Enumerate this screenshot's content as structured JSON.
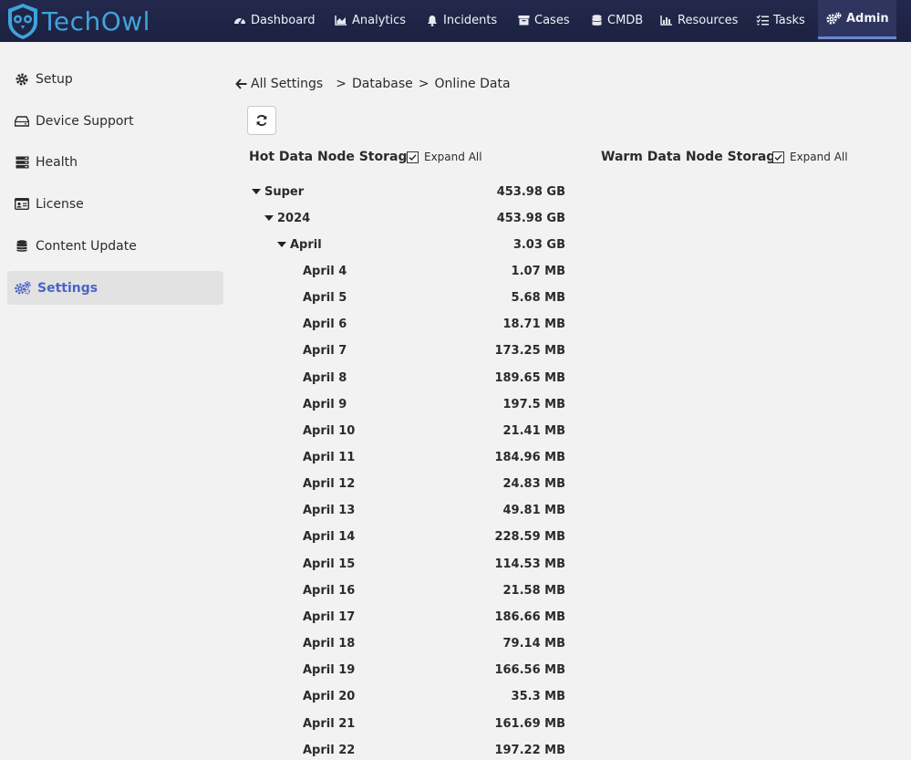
{
  "app": {
    "brand": "TechOwl",
    "brand_color": "#3fa3dc",
    "nav_bg": "#23294d",
    "accent": "#4a64c7"
  },
  "nav": {
    "items": [
      {
        "label": "Dashboard",
        "icon": "gauge-icon"
      },
      {
        "label": "Analytics",
        "icon": "area-chart-icon"
      },
      {
        "label": "Incidents",
        "icon": "bell-icon"
      },
      {
        "label": "Cases",
        "icon": "archive-icon"
      },
      {
        "label": "CMDB",
        "icon": "database-icon"
      },
      {
        "label": "Resources",
        "icon": "bar-chart-icon"
      },
      {
        "label": "Tasks",
        "icon": "tasks-icon"
      },
      {
        "label": "Admin",
        "icon": "gears-icon",
        "active": true
      }
    ]
  },
  "sidebar": {
    "items": [
      {
        "label": "Setup",
        "icon": "gear-icon"
      },
      {
        "label": "Device Support",
        "icon": "hdd-icon"
      },
      {
        "label": "Health",
        "icon": "server-icon"
      },
      {
        "label": "License",
        "icon": "id-card-icon"
      },
      {
        "label": "Content Update",
        "icon": "database-icon"
      },
      {
        "label": "Settings",
        "icon": "gears-icon",
        "active": true
      }
    ]
  },
  "breadcrumb": {
    "back_label": "All Settings",
    "path_1": "Database",
    "path_2": "Online Data",
    "separator": ">"
  },
  "hot_section": {
    "title": "Hot Data Node Storage",
    "expand_label": "Expand All",
    "expand_checked": true
  },
  "warm_section": {
    "title": "Warm Data Node Storage",
    "expand_label": "Expand All",
    "expand_checked": true
  },
  "tree": [
    {
      "label": "Super",
      "value": "453.98 GB",
      "level": 0,
      "expanded": true
    },
    {
      "label": "2024",
      "value": "453.98 GB",
      "level": 1,
      "expanded": true
    },
    {
      "label": "April",
      "value": "3.03 GB",
      "level": 2,
      "expanded": true
    },
    {
      "label": "April 4",
      "value": "1.07 MB",
      "level": 3
    },
    {
      "label": "April 5",
      "value": "5.68 MB",
      "level": 3
    },
    {
      "label": "April 6",
      "value": "18.71 MB",
      "level": 3
    },
    {
      "label": "April 7",
      "value": "173.25 MB",
      "level": 3
    },
    {
      "label": "April 8",
      "value": "189.65 MB",
      "level": 3
    },
    {
      "label": "April 9",
      "value": "197.5 MB",
      "level": 3
    },
    {
      "label": "April 10",
      "value": "21.41 MB",
      "level": 3
    },
    {
      "label": "April 11",
      "value": "184.96 MB",
      "level": 3
    },
    {
      "label": "April 12",
      "value": "24.83 MB",
      "level": 3
    },
    {
      "label": "April 13",
      "value": "49.81 MB",
      "level": 3
    },
    {
      "label": "April 14",
      "value": "228.59 MB",
      "level": 3
    },
    {
      "label": "April 15",
      "value": "114.53 MB",
      "level": 3
    },
    {
      "label": "April 16",
      "value": "21.58 MB",
      "level": 3
    },
    {
      "label": "April 17",
      "value": "186.66 MB",
      "level": 3
    },
    {
      "label": "April 18",
      "value": "79.14 MB",
      "level": 3
    },
    {
      "label": "April 19",
      "value": "166.56 MB",
      "level": 3
    },
    {
      "label": "April 20",
      "value": "35.3 MB",
      "level": 3
    },
    {
      "label": "April 21",
      "value": "161.69 MB",
      "level": 3
    },
    {
      "label": "April 22",
      "value": "197.22 MB",
      "level": 3
    }
  ]
}
